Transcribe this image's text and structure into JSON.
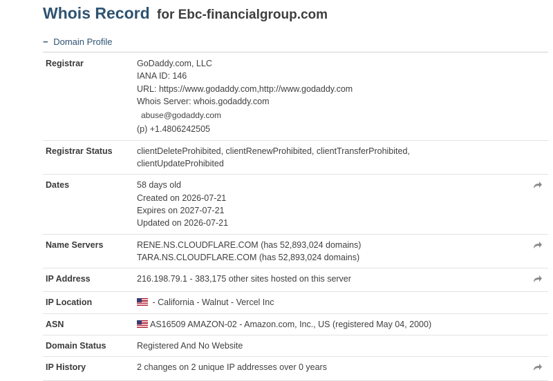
{
  "header": {
    "title": "Whois Record",
    "subtitle": "for Ebc-financialgroup.com"
  },
  "section": {
    "toggle_symbol": "−",
    "label": "Domain Profile"
  },
  "rows": {
    "registrar": {
      "key": "Registrar",
      "lines": [
        "GoDaddy.com, LLC",
        "IANA ID: 146",
        "URL: https://www.godaddy.com,http://www.godaddy.com",
        "Whois Server: whois.godaddy.com"
      ],
      "email": "abuse@godaddy.com",
      "phone": "(p)  +1.4806242505"
    },
    "registrar_status": {
      "key": "Registrar Status",
      "lines": [
        "clientDeleteProhibited, clientRenewProhibited, clientTransferProhibited,",
        "clientUpdateProhibited"
      ]
    },
    "dates": {
      "key": "Dates",
      "lines": [
        "58 days old",
        "Created on 2026-07-21",
        "Expires on 2027-07-21",
        "Updated on 2026-07-21"
      ]
    },
    "name_servers": {
      "key": "Name Servers",
      "lines": [
        "RENE.NS.CLOUDFLARE.COM (has 52,893,024 domains)",
        "TARA.NS.CLOUDFLARE.COM (has 52,893,024 domains)"
      ]
    },
    "ip_address": {
      "key": "IP Address",
      "value": "216.198.79.1 - 383,175 other sites hosted on this server"
    },
    "ip_location": {
      "key": "IP Location",
      "value": " - California - Walnut - Vercel Inc"
    },
    "asn": {
      "key": "ASN",
      "value": "AS16509 AMAZON-02 - Amazon.com, Inc., US (registered May 04, 2000)"
    },
    "domain_status": {
      "key": "Domain Status",
      "value": "Registered And No Website"
    },
    "ip_history": {
      "key": "IP History",
      "value": "2 changes on 2 unique IP addresses over 0 years"
    }
  },
  "icons": {
    "share": "share-arrow-icon",
    "flag": "us-flag-icon"
  },
  "colors": {
    "title": "#2e5371",
    "text": "#3a3a3a",
    "divider": "#e2e2e2",
    "icon": "#8a8a8a"
  }
}
